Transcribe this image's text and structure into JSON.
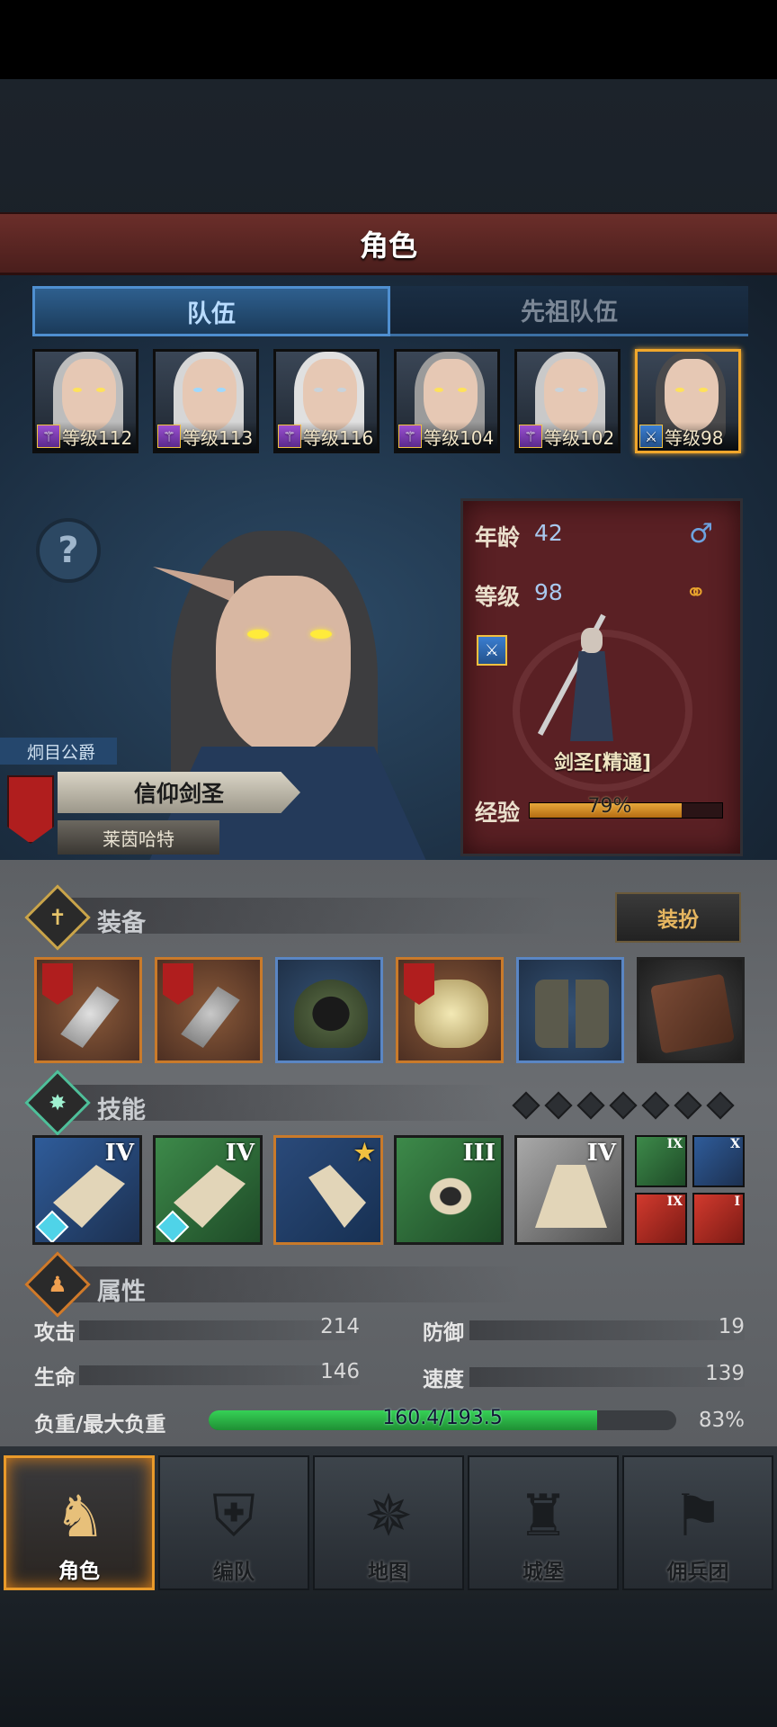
{
  "header": {
    "title": "角色"
  },
  "tabs": [
    {
      "label": "队伍",
      "active": true
    },
    {
      "label": "先祖队伍",
      "active": false
    }
  ],
  "roster": [
    {
      "level_text": "等级112",
      "class_icon": "staff-icon"
    },
    {
      "level_text": "等级113",
      "class_icon": "staff-icon"
    },
    {
      "level_text": "等级116",
      "class_icon": "staff-icon"
    },
    {
      "level_text": "等级104",
      "class_icon": "staff-icon"
    },
    {
      "level_text": "等级102",
      "class_icon": "staff-icon"
    },
    {
      "level_text": "等级98",
      "class_icon": "sword-icon",
      "selected": true
    }
  ],
  "hero": {
    "title_small": "炯目公爵",
    "class_title": "信仰剑圣",
    "name": "莱茵哈特"
  },
  "info": {
    "age_label": "年龄",
    "age_value": "42",
    "level_label": "等级",
    "level_value": "98",
    "class_name": "剑圣[精通]",
    "exp_label": "经验",
    "exp_percent_text": "79%",
    "exp_fraction": 0.79,
    "gender_icon": "male-icon",
    "ring_icon": "wedding-rings-icon"
  },
  "equipment": {
    "label": "装备",
    "dress_button": "装扮",
    "slots": [
      {
        "name": "halberd",
        "rarity": "orange"
      },
      {
        "name": "halberd",
        "rarity": "orange"
      },
      {
        "name": "hood",
        "rarity": "blue"
      },
      {
        "name": "golden-armor",
        "rarity": "orange"
      },
      {
        "name": "boots",
        "rarity": "blue"
      },
      {
        "name": "tome",
        "rarity": "plain"
      }
    ]
  },
  "skills": {
    "label": "技能",
    "main": [
      {
        "rank": "IV",
        "style": "blue",
        "gem": true
      },
      {
        "rank": "IV",
        "style": "green",
        "gem": true
      },
      {
        "rank": "",
        "style": "blue-star",
        "gem": false
      },
      {
        "rank": "III",
        "style": "green-target",
        "gem": false
      },
      {
        "rank": "IV",
        "style": "gray",
        "gem": false
      }
    ],
    "mini": [
      {
        "rank": "IX",
        "color": "green"
      },
      {
        "rank": "X",
        "color": "blue"
      },
      {
        "rank": "IX",
        "color": "red"
      },
      {
        "rank": "I",
        "color": "red"
      }
    ]
  },
  "attributes": {
    "label": "属性",
    "attack_label": "攻击",
    "attack_value": "214",
    "defense_label": "防御",
    "defense_value": "19",
    "hp_label": "生命",
    "hp_value": "146",
    "speed_label": "速度",
    "speed_value": "139",
    "weight_label": "负重/最大负重",
    "weight_text": "160.4/193.5",
    "weight_percent": "83%",
    "weight_fraction": 0.83
  },
  "nav": [
    {
      "label": "角色",
      "icon": "knight-icon",
      "active": true
    },
    {
      "label": "编队",
      "icon": "formation-icon",
      "active": false
    },
    {
      "label": "地图",
      "icon": "compass-icon",
      "active": false
    },
    {
      "label": "城堡",
      "icon": "castle-icon",
      "active": false
    },
    {
      "label": "佣兵团",
      "icon": "mercenary-icon",
      "active": false
    }
  ]
}
